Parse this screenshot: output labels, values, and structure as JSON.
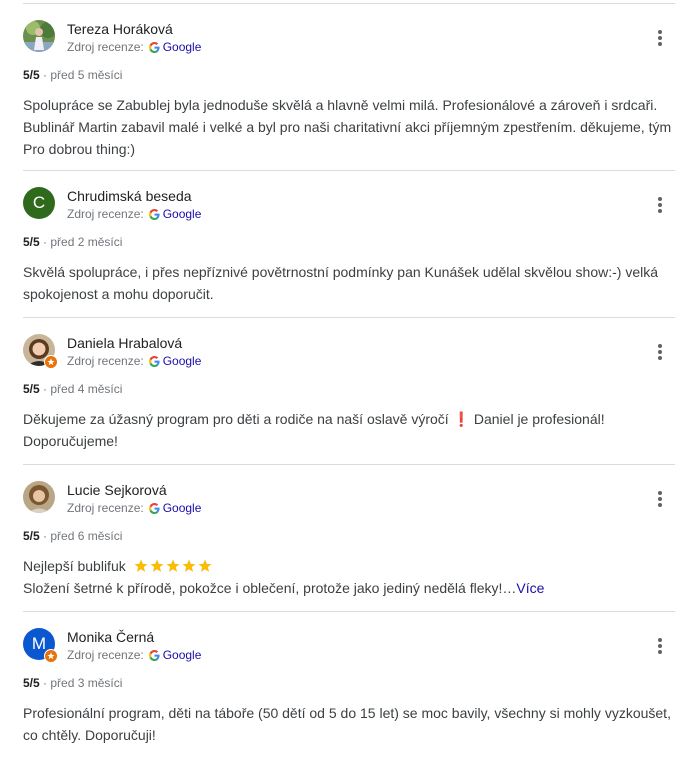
{
  "reviews": [
    {
      "name": "Tereza Horáková",
      "source_label": "Zdroj recenze:",
      "source_name": "Google",
      "score": "5/5",
      "time": "před 5 měsíci",
      "text_lines": [
        "Spolupráce se Zabublej byla jednoduše skvělá a hlavně velmi milá. Profesionálové a zároveň i srdcaři.",
        "Bublinář Martin zabavil malé i velké a byl pro naši charitativní akci příjemným zpestřením. děkujeme, tým",
        "Pro dobrou thing:)"
      ]
    },
    {
      "name": "Chrudimská beseda",
      "avatar_letter": "C",
      "source_label": "Zdroj recenze:",
      "source_name": "Google",
      "score": "5/5",
      "time": "před 2 měsíci",
      "text_lines": [
        "Skvělá spolupráce, i přes nepříznivé povětrnostní podmínky pan Kunášek udělal skvělou show:-) velká",
        "spokojenost a mohu doporučit."
      ]
    },
    {
      "name": "Daniela Hrabalová",
      "source_label": "Zdroj recenze:",
      "source_name": "Google",
      "score": "5/5",
      "time": "před 4 měsíci",
      "text_lines": [
        "Děkujeme za úžasný program pro děti a rodiče na naší oslavě výročí ❗ Daniel je profesionál!",
        "Doporučujeme!"
      ]
    },
    {
      "name": "Lucie Sejkorová",
      "source_label": "Zdroj recenze:",
      "source_name": "Google",
      "score": "5/5",
      "time": "před 6 měsíci",
      "text_first": "Nejlepší bublifuk",
      "text_second": "Složení šetrné k přírodě, pokožce i oblečení, protože jako jediný nedělá fleky!…",
      "more_label": "Více"
    },
    {
      "name": "Monika Černá",
      "avatar_letter": "M",
      "source_label": "Zdroj recenze:",
      "source_name": "Google",
      "score": "5/5",
      "time": "před 3 měsíci",
      "text_lines": [
        "Profesionální program, děti na táboře (50 dětí od 5 do 15 let) se moc bavily, všechny si mohly vyzkoušet,",
        "co chtěly. Doporučuji!"
      ]
    }
  ],
  "separator": "·",
  "colors": {
    "google_link": "#1a0dab",
    "avatar_c": "#2f6a1c",
    "avatar_m": "#0b57d0",
    "local_guide": "#e8710a",
    "star": "#fbbc04"
  },
  "icons": {
    "menu": "more-vert-icon",
    "source": "google-g-icon",
    "star": "star-icon"
  }
}
